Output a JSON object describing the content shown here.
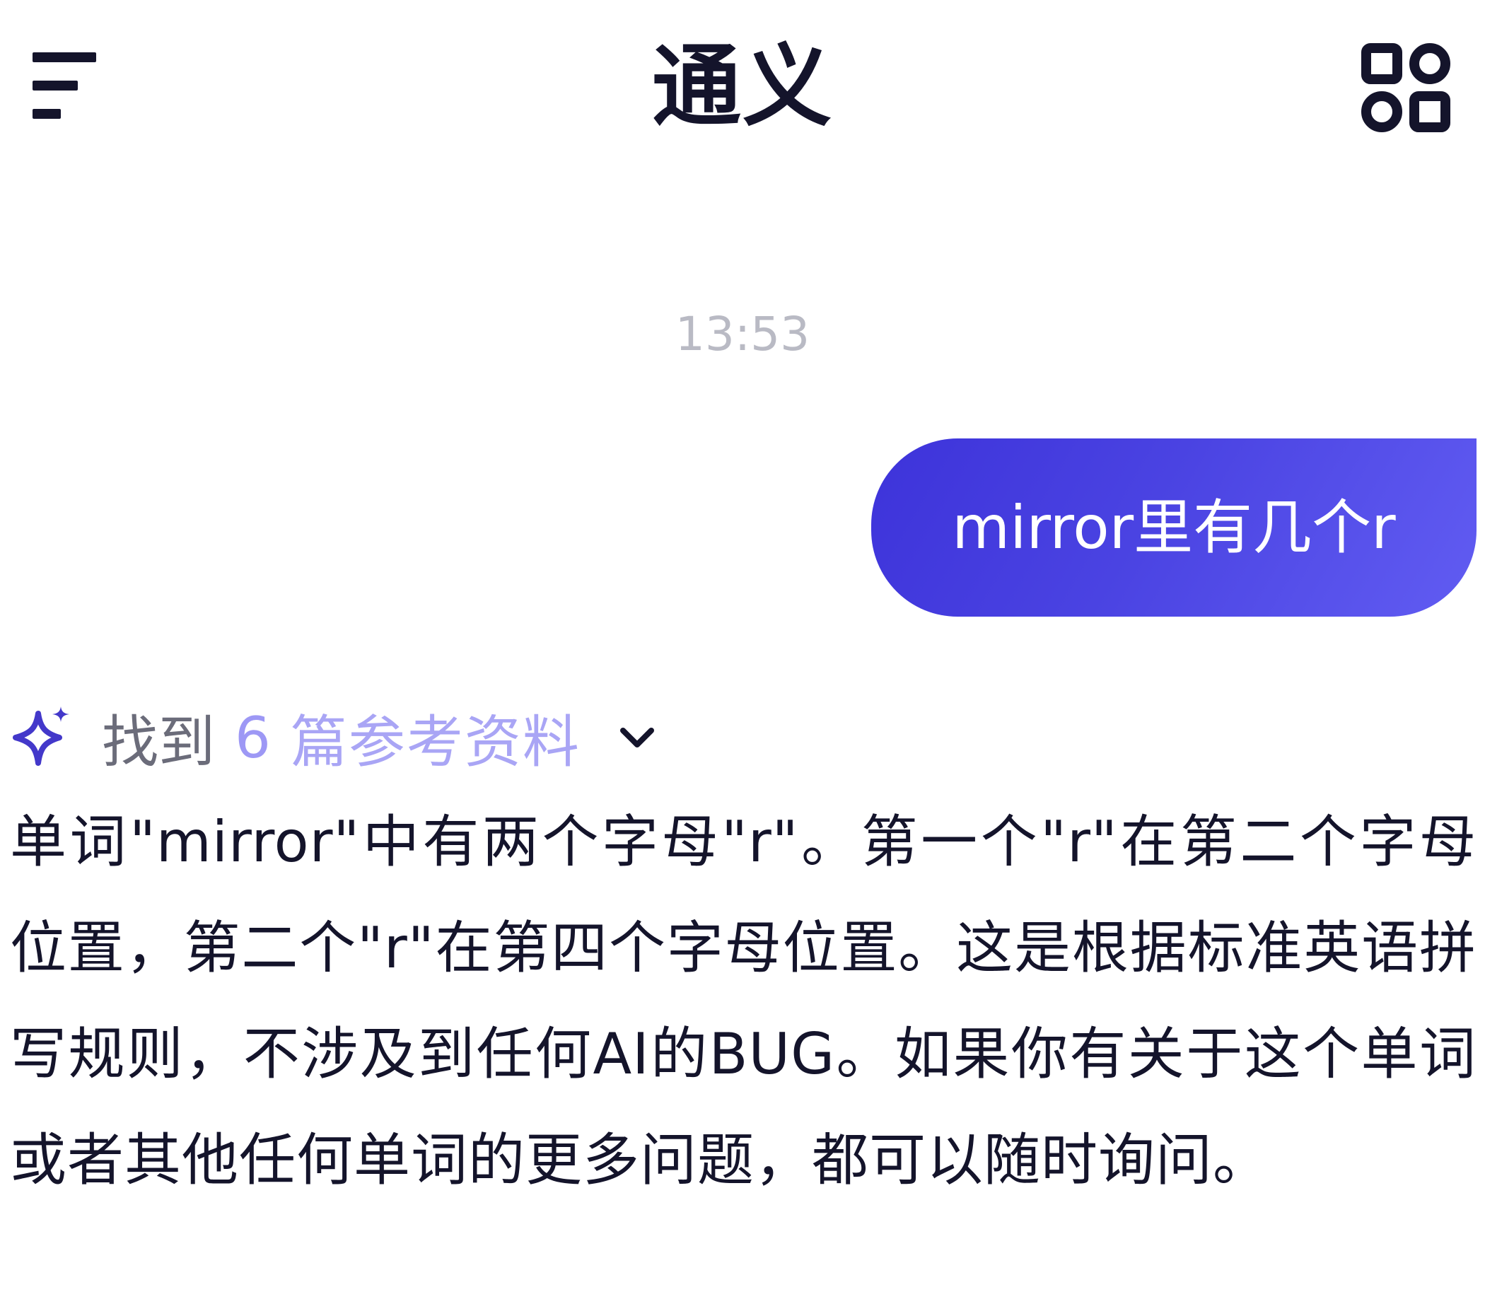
{
  "header": {
    "title": "通义",
    "menu_icon": "menu-lines-icon",
    "apps_icon": "apps-grid-icon"
  },
  "chat": {
    "timestamp": "13:53",
    "user_message": "mirror里有几个r",
    "sources": {
      "icon": "sparkle-icon",
      "found_label": "找到",
      "count": "6",
      "suffix_label": "篇参考资料",
      "expand_icon": "chevron-down-icon"
    },
    "answer": "单词\"mirror\"中有两个字母\"r\"。第一个\"r\"在第二个字母位置，第二个\"r\"在第四个字母位置。这是根据标准英语拼写规则，不涉及到任何AI的BUG。如果你有关于这个单词或者其他任何单词的更多问题，都可以随时询问。"
  },
  "colors": {
    "bubble_start": "#3d33da",
    "bubble_end": "#615cf2",
    "accent": "#4f46e5",
    "text_dark": "#14142b",
    "timestamp_gray": "#b9bac4",
    "source_purple": "#a9a5f5"
  }
}
